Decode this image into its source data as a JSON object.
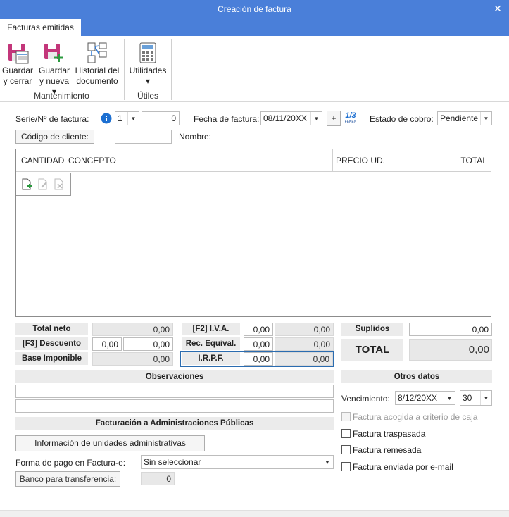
{
  "window": {
    "title": "Creación de factura",
    "close_glyph": "✕"
  },
  "tab": {
    "label": "Facturas emitidas"
  },
  "ribbon": {
    "save_close": "Guardar\ny cerrar",
    "save_new": "Guardar\ny nueva ▾",
    "history": "Historial del\ndocumento",
    "utilities": "Utilidades\n▾",
    "group_maintenance": "Mantenimiento",
    "group_utiles": "Útiles"
  },
  "header": {
    "series_label": "Serie/Nº de factura:",
    "series_value": "1",
    "number_value": "0",
    "invoice_date_label": "Fecha de factura:",
    "invoice_date_value": "08/11/20XX",
    "plus_label": "+",
    "logo_text": "1/3",
    "logo_sub": "FEKEN",
    "payment_status_label": "Estado de cobro:",
    "payment_status_value": "Pendiente",
    "client_code_button": "Código de cliente:",
    "name_label": "Nombre:"
  },
  "grid": {
    "columns": [
      "CANTIDAD",
      "CONCEPTO",
      "PRECIO UD.",
      "TOTAL"
    ]
  },
  "totals": {
    "net_label": "Total neto",
    "net_value": "0,00",
    "discount_label": "[F3] Descuento",
    "discount_pct": "0,00",
    "discount_value": "0,00",
    "base_label": "Base Imponible",
    "base_value": "0,00",
    "iva_label": "[F2] I.V.A.",
    "iva_pct": "0,00",
    "iva_value": "0,00",
    "re_label": "Rec. Equival.",
    "re_pct": "0,00",
    "re_value": "0,00",
    "irpf_label": "I.R.P.F.",
    "irpf_pct": "0,00",
    "irpf_value": "0,00",
    "suplidos_label": "Suplidos",
    "suplidos_value": "0,00",
    "total_label": "TOTAL",
    "total_value": "0,00"
  },
  "observations": {
    "label": "Observaciones"
  },
  "public_admin": {
    "section_label": "Facturación a Administraciones Públicas",
    "units_button": "Información de unidades administrativas",
    "payment_method_label": "Forma de pago en Factura-e:",
    "payment_method_value": "Sin seleccionar",
    "bank_button": "Banco para transferencia:",
    "bank_value": "0"
  },
  "other": {
    "section_label": "Otros datos",
    "due_label": "Vencimiento:",
    "due_date": "8/12/20XX",
    "due_days": "30",
    "cash_criteria": "Factura acogida a criterio de caja",
    "transferred": "Factura traspasada",
    "remitted": "Factura remesada",
    "emailed": "Factura enviada por e-mail"
  },
  "colors": {
    "titlebar": "#4a7fd9",
    "info": "#1c6fd1",
    "focus_border": "#2b6cb0"
  }
}
